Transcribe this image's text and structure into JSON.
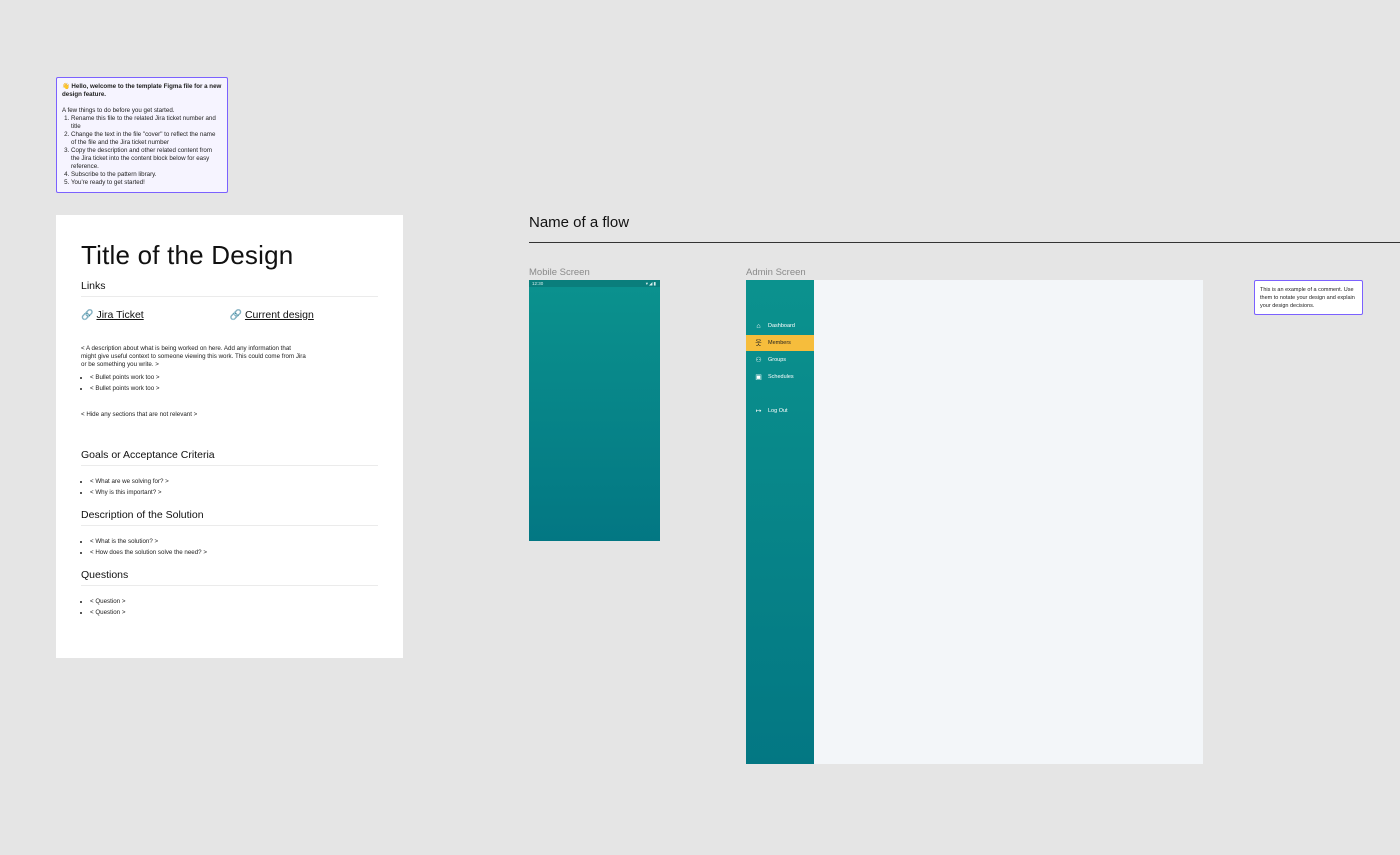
{
  "sticky": {
    "title": "👋 Hello, welcome to the template Figma file for a new design feature.",
    "intro": "A few things to do before you get started.",
    "steps": [
      "Rename this file to the related Jira ticket number and title",
      "Change the text in the file \"cover\" to reflect the name of the file and the Jira ticket number",
      "Copy the description and other related content from the Jira ticket into the content block below for easy reference.",
      "Subscribe to the pattern library.",
      "You're ready to get started!"
    ]
  },
  "doc": {
    "title": "Title of the Design",
    "links_heading": "Links",
    "links": [
      {
        "icon": "link-icon",
        "label": "Jira Ticket"
      },
      {
        "icon": "link-icon",
        "label": "Current design"
      }
    ],
    "description": "< A description about what is being worked on here. Add any information that might give useful context to someone viewing this work. This could come from Jira or be something you write. >",
    "bullets": [
      "< Bullet points work too >",
      "< Bullet points work too >"
    ],
    "hide_note": "< Hide any sections that are not relevant >",
    "goals_heading": "Goals or Acceptance Criteria",
    "goals": [
      "< What are we solving for? >",
      "< Why is this important? >"
    ],
    "solution_heading": "Description of the Solution",
    "solution": [
      "< What is the solution? >",
      "< How does the solution solve the need? >"
    ],
    "questions_heading": "Questions",
    "questions": [
      "< Question >",
      "< Question >"
    ]
  },
  "flow": {
    "title": "Name of a flow",
    "mobile_label": "Mobile Screen",
    "admin_label": "Admin Screen",
    "mobile_time": "12:30",
    "mobile_status_icons": [
      "wifi-icon",
      "signal-icon",
      "battery-icon"
    ],
    "admin_nav": [
      {
        "label": "Dashboard",
        "icon": "home-icon",
        "active": false
      },
      {
        "label": "Members",
        "icon": "person-icon",
        "active": true
      },
      {
        "label": "Groups",
        "icon": "group-icon",
        "active": false
      },
      {
        "label": "Schedules",
        "icon": "calendar-icon",
        "active": false
      },
      {
        "label": "Log Out",
        "icon": "logout-icon",
        "active": false
      }
    ],
    "colors": {
      "teal_top": "#0b928e",
      "teal_bottom": "#037783",
      "active": "#f6bd3c",
      "canvas": "#e5e5e5",
      "accent": "#7b61ff"
    }
  },
  "comment": {
    "text": "This is an example of a comment. Use them to notate your design and explain your design decisions."
  }
}
